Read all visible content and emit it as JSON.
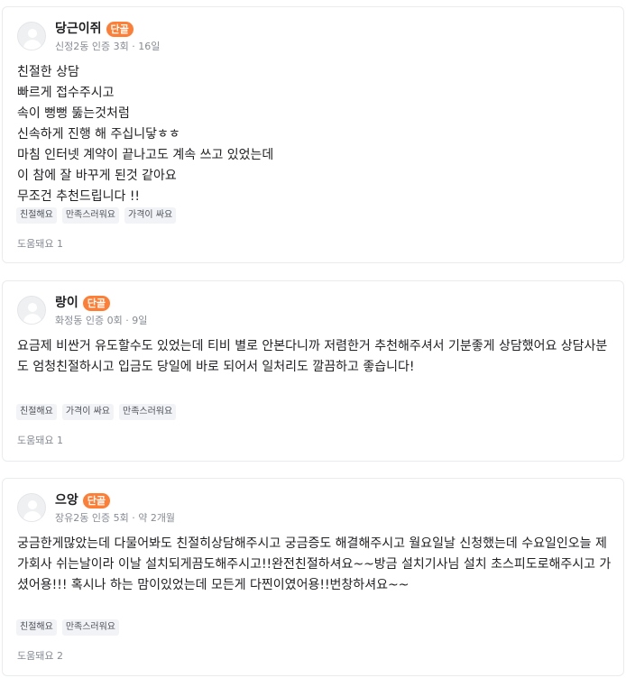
{
  "reviews": [
    {
      "nickname": "당근이쥐",
      "badge": "단골",
      "meta": "신정2동 인증 3회 · 16일",
      "text": "친절한 상담\n빠르게 접수주시고\n속이 뻥뻥 뚫는것처럼\n신속하게 진행 해 주십니닿ㅎㅎ\n마침 인터넷 계약이 끝나고도 계속 쓰고 있었는데\n이 참에 잘 바꾸게 된것 같아요\n무조건 추천드립니다 !!",
      "tags": [
        "친절해요",
        "만족스러워요",
        "가격이 싸요"
      ],
      "helpful": "도움돼요 1"
    },
    {
      "nickname": "랑이",
      "badge": "단골",
      "meta": "화정동 인증 0회 · 9일",
      "text": "요금제 비싼거 유도할수도 있었는데 티비 별로 안본다니까 저렴한거 추천해주셔서 기분좋게 상담했어요 상담사분도 엄청친절하시고 입금도 당일에 바로 되어서 일처리도 깔끔하고 좋습니다!",
      "tags": [
        "친절해요",
        "가격이 싸요",
        "만족스러워요"
      ],
      "helpful": "도움돼요 1"
    },
    {
      "nickname": "으앙",
      "badge": "단골",
      "meta": "장유2동 인증 5회 · 약 2개월",
      "text": "궁금한게많았는데 다물어봐도 친절히상담해주시고 궁금증도 해결해주시고 월요일날 신청했는데 수요일인오늘 제가회사 쉬는날이라 이날 설치되게끔도해주시고!!완전친절하셔요~~방금 설치기사님 설치 초스피도로해주시고 가셨어용!!! 혹시나 하는 맘이있었는데 모든게 다찐이였어용!!번창하셔요~~",
      "tags": [
        "친절해요",
        "만족스러워요"
      ],
      "helpful": "도움돼요 2"
    }
  ]
}
